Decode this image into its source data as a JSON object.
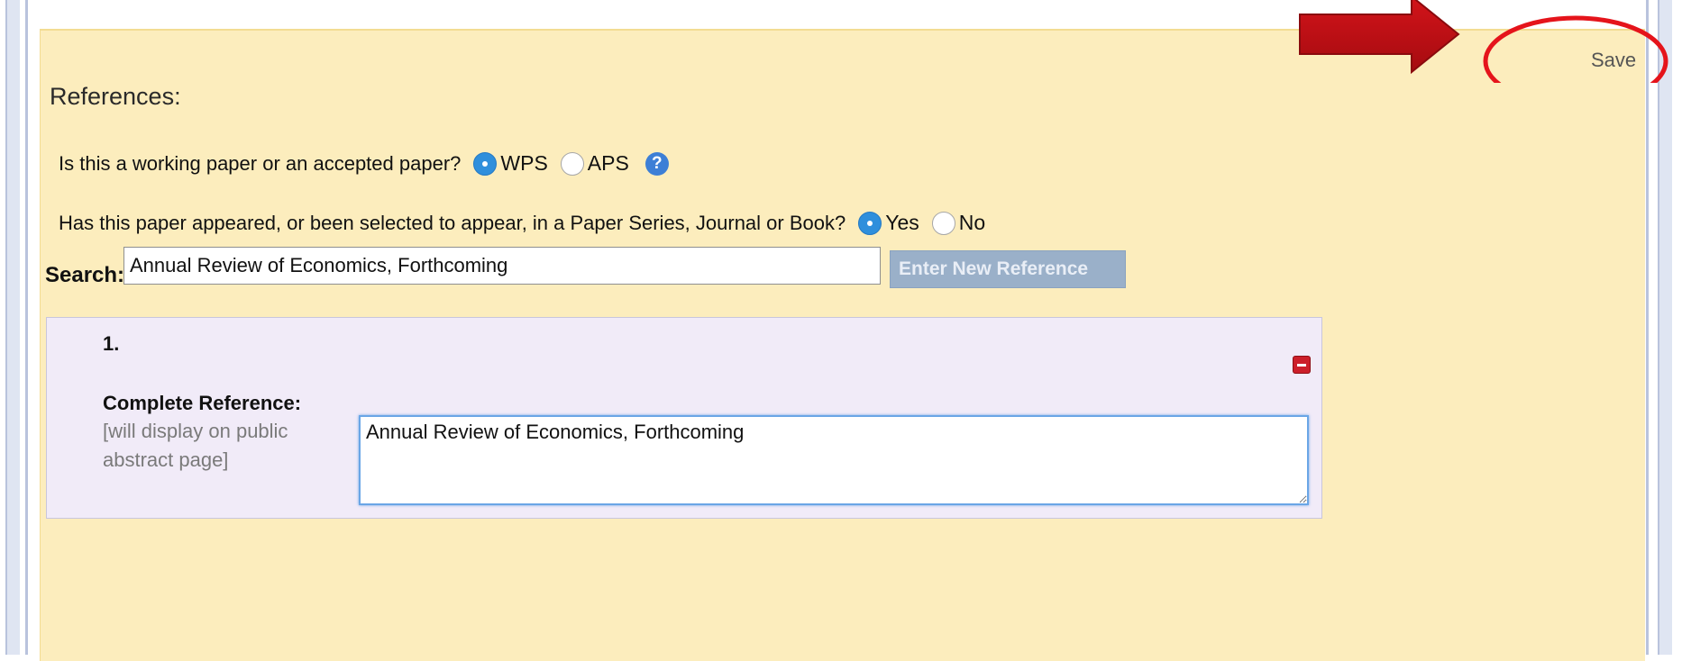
{
  "header": {
    "save_label": "Save"
  },
  "section": {
    "title": "References:"
  },
  "questions": {
    "paper_type": {
      "label": "Is this a working paper or an accepted paper?",
      "options": [
        {
          "label": "WPS",
          "checked": true
        },
        {
          "label": "APS",
          "checked": false
        }
      ],
      "help_glyph": "?"
    },
    "appeared": {
      "label": "Has this paper appeared, or been selected to appear, in a Paper Series, Journal or Book?",
      "options": [
        {
          "label": "Yes",
          "checked": true
        },
        {
          "label": "No",
          "checked": false
        }
      ]
    }
  },
  "search": {
    "label": "Search:",
    "value": "Annual Review of Economics, Forthcoming",
    "button_label": "Enter New Reference"
  },
  "reference": {
    "number": "1.",
    "complete_label": "Complete Reference:",
    "hint": "[will display on public abstract page]",
    "value": "Annual Review of Economics, Forthcoming"
  },
  "colors": {
    "panel_bg": "#fcedbd",
    "ref_box_bg": "#f1ebf8",
    "radio_checked": "#2f8fdc",
    "annotation_red": "#c40d12"
  },
  "icons": {
    "help": "help-icon",
    "remove": "remove-icon",
    "annotation_arrow": "arrow-right-icon",
    "annotation_circle": "circle-highlight-icon"
  }
}
